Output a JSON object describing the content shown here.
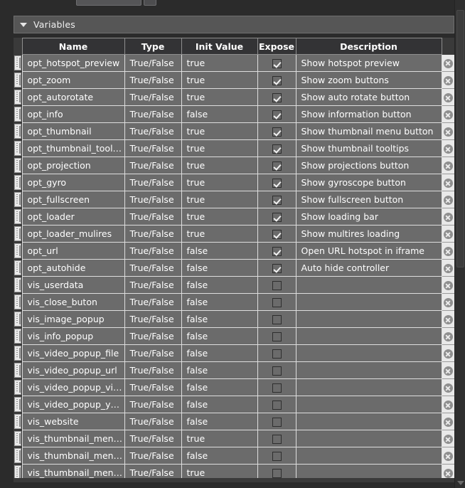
{
  "section": {
    "title": "Variables",
    "disclosure_icon": "triangle-down-icon",
    "expanded": true
  },
  "table": {
    "columns": [
      "Name",
      "Type",
      "Init Value",
      "Expose",
      "Description"
    ],
    "delete_icon": "circle-x-icon",
    "drag_handle_icon": "drag-grip-icon",
    "rows": [
      {
        "name": "opt_hotspot_preview",
        "type": "True/False",
        "init": "true",
        "expose": true,
        "description": "Show hotspot preview"
      },
      {
        "name": "opt_zoom",
        "type": "True/False",
        "init": "true",
        "expose": true,
        "description": "Show zoom buttons"
      },
      {
        "name": "opt_autorotate",
        "type": "True/False",
        "init": "true",
        "expose": true,
        "description": "Show auto rotate button"
      },
      {
        "name": "opt_info",
        "type": "True/False",
        "init": "false",
        "expose": true,
        "description": "Show information button"
      },
      {
        "name": "opt_thumbnail",
        "type": "True/False",
        "init": "true",
        "expose": true,
        "description": "Show thumbnail menu button"
      },
      {
        "name": "opt_thumbnail_tool…",
        "type": "True/False",
        "init": "true",
        "expose": true,
        "description": "Show thumbnail tooltips"
      },
      {
        "name": "opt_projection",
        "type": "True/False",
        "init": "true",
        "expose": true,
        "description": "Show projections button"
      },
      {
        "name": "opt_gyro",
        "type": "True/False",
        "init": "true",
        "expose": true,
        "description": "Show gyroscope button"
      },
      {
        "name": "opt_fullscreen",
        "type": "True/False",
        "init": "true",
        "expose": true,
        "description": "Show fullscreen button"
      },
      {
        "name": "opt_loader",
        "type": "True/False",
        "init": "true",
        "expose": true,
        "description": "Show loading bar"
      },
      {
        "name": "opt_loader_mulires",
        "type": "True/False",
        "init": "true",
        "expose": true,
        "description": "Show multires loading"
      },
      {
        "name": "opt_url",
        "type": "True/False",
        "init": "false",
        "expose": true,
        "description": "Open URL hotspot in iframe"
      },
      {
        "name": "opt_autohide",
        "type": "True/False",
        "init": "false",
        "expose": true,
        "description": "Auto hide controller"
      },
      {
        "name": "vis_userdata",
        "type": "True/False",
        "init": "false",
        "expose": false,
        "description": ""
      },
      {
        "name": "vis_close_buton",
        "type": "True/False",
        "init": "false",
        "expose": false,
        "description": ""
      },
      {
        "name": "vis_image_popup",
        "type": "True/False",
        "init": "false",
        "expose": false,
        "description": ""
      },
      {
        "name": "vis_info_popup",
        "type": "True/False",
        "init": "false",
        "expose": false,
        "description": ""
      },
      {
        "name": "vis_video_popup_file",
        "type": "True/False",
        "init": "false",
        "expose": false,
        "description": ""
      },
      {
        "name": "vis_video_popup_url",
        "type": "True/False",
        "init": "false",
        "expose": false,
        "description": ""
      },
      {
        "name": "vis_video_popup_vi…",
        "type": "True/False",
        "init": "false",
        "expose": false,
        "description": ""
      },
      {
        "name": "vis_video_popup_y…",
        "type": "True/False",
        "init": "false",
        "expose": false,
        "description": ""
      },
      {
        "name": "vis_website",
        "type": "True/False",
        "init": "false",
        "expose": false,
        "description": ""
      },
      {
        "name": "vis_thumbnail_men…",
        "type": "True/False",
        "init": "true",
        "expose": false,
        "description": ""
      },
      {
        "name": "vis_thumbnail_men…",
        "type": "True/False",
        "init": "false",
        "expose": false,
        "description": ""
      },
      {
        "name": "vis_thumbnail_men…",
        "type": "True/False",
        "init": "true",
        "expose": false,
        "description": ""
      }
    ]
  },
  "scrollbar": {
    "orientation": "vertical",
    "down_arrow_icon": "triangle-down-icon"
  },
  "colors": {
    "window_bg": "#2b2b2b",
    "section_header_bg": "#565656",
    "table_header_bg": "#333335",
    "row_bg": "#6b6b6b",
    "row_border": "#dedede",
    "text": "#ffffff",
    "handle_bg": "#e9e9e9"
  }
}
